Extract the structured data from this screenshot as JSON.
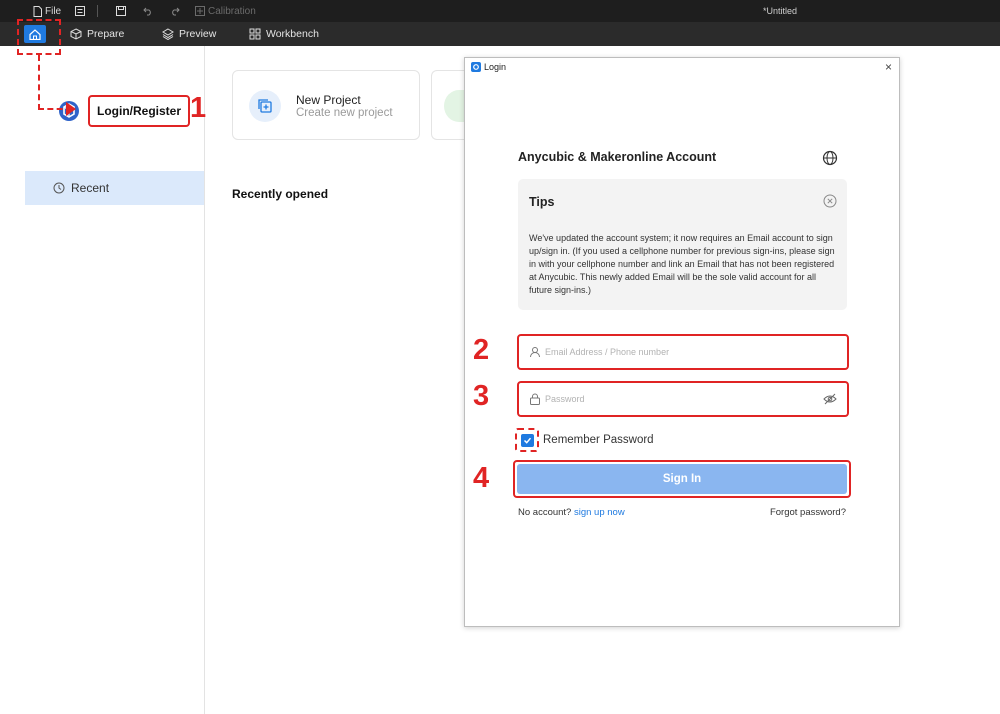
{
  "titlebar": {
    "file_label": "File",
    "calibration_label": "Calibration",
    "window_title": "*Untitled"
  },
  "tabs": [
    {
      "label": "Prepare",
      "icon": "cube-icon"
    },
    {
      "label": "Preview",
      "icon": "layers-icon"
    },
    {
      "label": "Workbench",
      "icon": "grid-icon"
    }
  ],
  "sidebar": {
    "login_label": "Login/Register",
    "recent_label": "Recent"
  },
  "main": {
    "new_project_title": "New Project",
    "new_project_subtitle": "Create new project",
    "recently_opened": "Recently opened"
  },
  "dialog": {
    "title": "Login",
    "account_title": "Anycubic & Makeronline Account",
    "tips_title": "Tips",
    "tips_body": "We've updated the account system; it now requires an Email account to sign up/sign in. (If you used a cellphone number for previous sign-ins, please sign in with your cellphone number and link an Email that has not been registered at Anycubic. This newly added Email will be the sole valid account for all future sign-ins.)",
    "email_placeholder": "Email Address / Phone number",
    "password_placeholder": "Password",
    "remember_label": "Remember Password",
    "remember_checked": true,
    "signin_label": "Sign In",
    "no_account_text": "No account?",
    "signup_link": "sign up now",
    "forgot_link": "Forgot password?"
  },
  "annotations": {
    "step1": "1",
    "step2": "2",
    "step3": "3",
    "step4": "4"
  },
  "colors": {
    "accent": "#1f7ae0",
    "annotation": "#e02424",
    "signin_button": "#8ab6f0",
    "recent_highlight": "#dbe9fb"
  }
}
